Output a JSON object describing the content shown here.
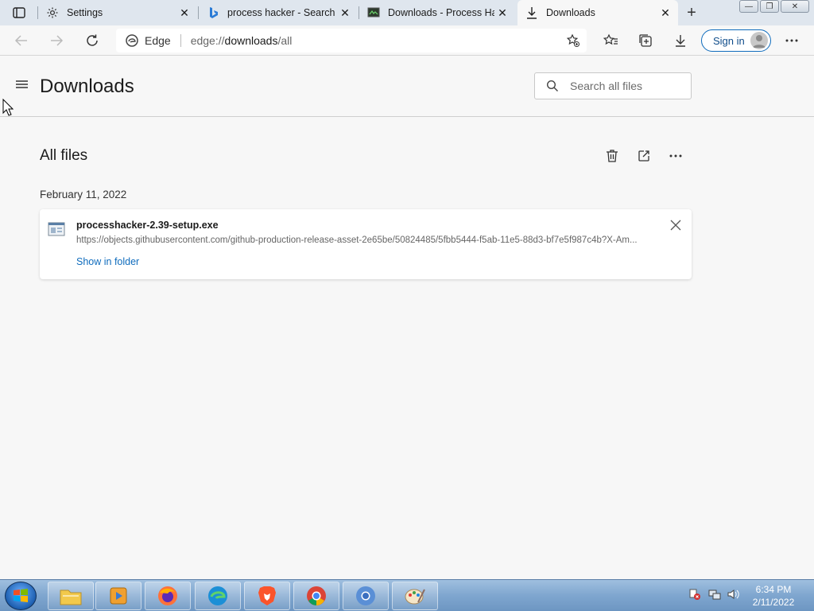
{
  "tabs": [
    {
      "label": "Settings",
      "icon": "gear-icon"
    },
    {
      "label": "process hacker - Search",
      "icon": "bing-icon"
    },
    {
      "label": "Downloads - Process Hac",
      "icon": "process-hacker-icon"
    },
    {
      "label": "Downloads",
      "icon": "download-icon",
      "active": true
    }
  ],
  "address": {
    "site_label": "Edge",
    "url_prefix": "edge://",
    "url_path": "downloads",
    "url_suffix": "/all"
  },
  "toolbar": {
    "signin_label": "Sign in"
  },
  "page": {
    "title": "Downloads",
    "search_placeholder": "Search all files",
    "section_title": "All files",
    "date_group": "February 11, 2022"
  },
  "downloads": [
    {
      "filename": "processhacker-2.39-setup.exe",
      "url": "https://objects.githubusercontent.com/github-production-release-asset-2e65be/50824485/5fbb5444-f5ab-11e5-88d3-bf7e5f987c4b?X-Am...",
      "action_label": "Show in folder"
    }
  ],
  "taskbar": {
    "apps": [
      "explorer",
      "media-player",
      "firefox",
      "edge",
      "brave",
      "chrome",
      "chromium",
      "paint"
    ],
    "time": "6:34 PM",
    "date": "2/11/2022"
  },
  "colors": {
    "accent": "#0f6cbd",
    "page_bg": "#f7f7f7",
    "tabstrip_bg": "#dfe6ee"
  }
}
